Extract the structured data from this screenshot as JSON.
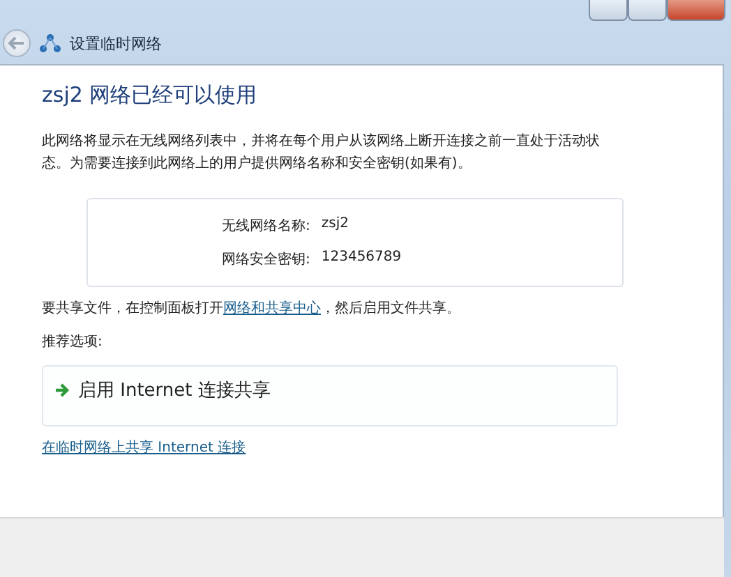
{
  "window": {
    "title": "设置临时网络"
  },
  "heading": "zsj2 网络已经可以使用",
  "description": "此网络将显示在无线网络列表中，并将在每个用户从该网络上断开连接之前一直处于活动状态。为需要连接到此网络上的用户提供网络名称和安全密钥(如果有)。",
  "details": [
    {
      "label": "无线网络名称:",
      "value": "zsj2"
    },
    {
      "label": "网络安全密钥:",
      "value": "123456789"
    }
  ],
  "share_note": {
    "before": "要共享文件，在控制面板打开",
    "link": "网络和共享中心",
    "after": "，然后启用文件共享。"
  },
  "recommended_label": "推荐选项:",
  "options": [
    {
      "label": "启用 Internet 连接共享"
    }
  ],
  "bottom_link": "在临时网络上共享 Internet 连接"
}
